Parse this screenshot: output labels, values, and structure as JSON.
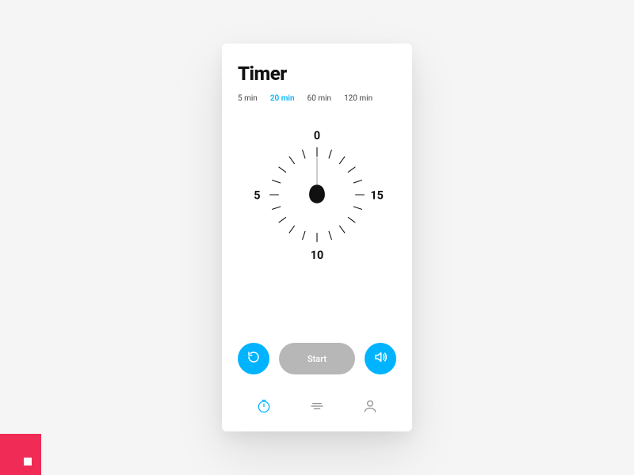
{
  "title": "Timer",
  "accent": "#00b3ff",
  "presets": [
    {
      "label": "5 min",
      "active": false
    },
    {
      "label": "20 min",
      "active": true
    },
    {
      "label": "60 min",
      "active": false
    },
    {
      "label": "120 min",
      "active": false
    }
  ],
  "dial": {
    "top": "0",
    "right": "15",
    "bottom": "10",
    "left": "5",
    "total_minutes": 20,
    "pointer_minute": 0
  },
  "controls": {
    "reset_icon": "reset",
    "start_label": "Start",
    "sound_icon": "sound"
  },
  "nav": {
    "timer_icon": "timer",
    "list_icon": "list",
    "profile_icon": "profile",
    "active": "timer"
  }
}
